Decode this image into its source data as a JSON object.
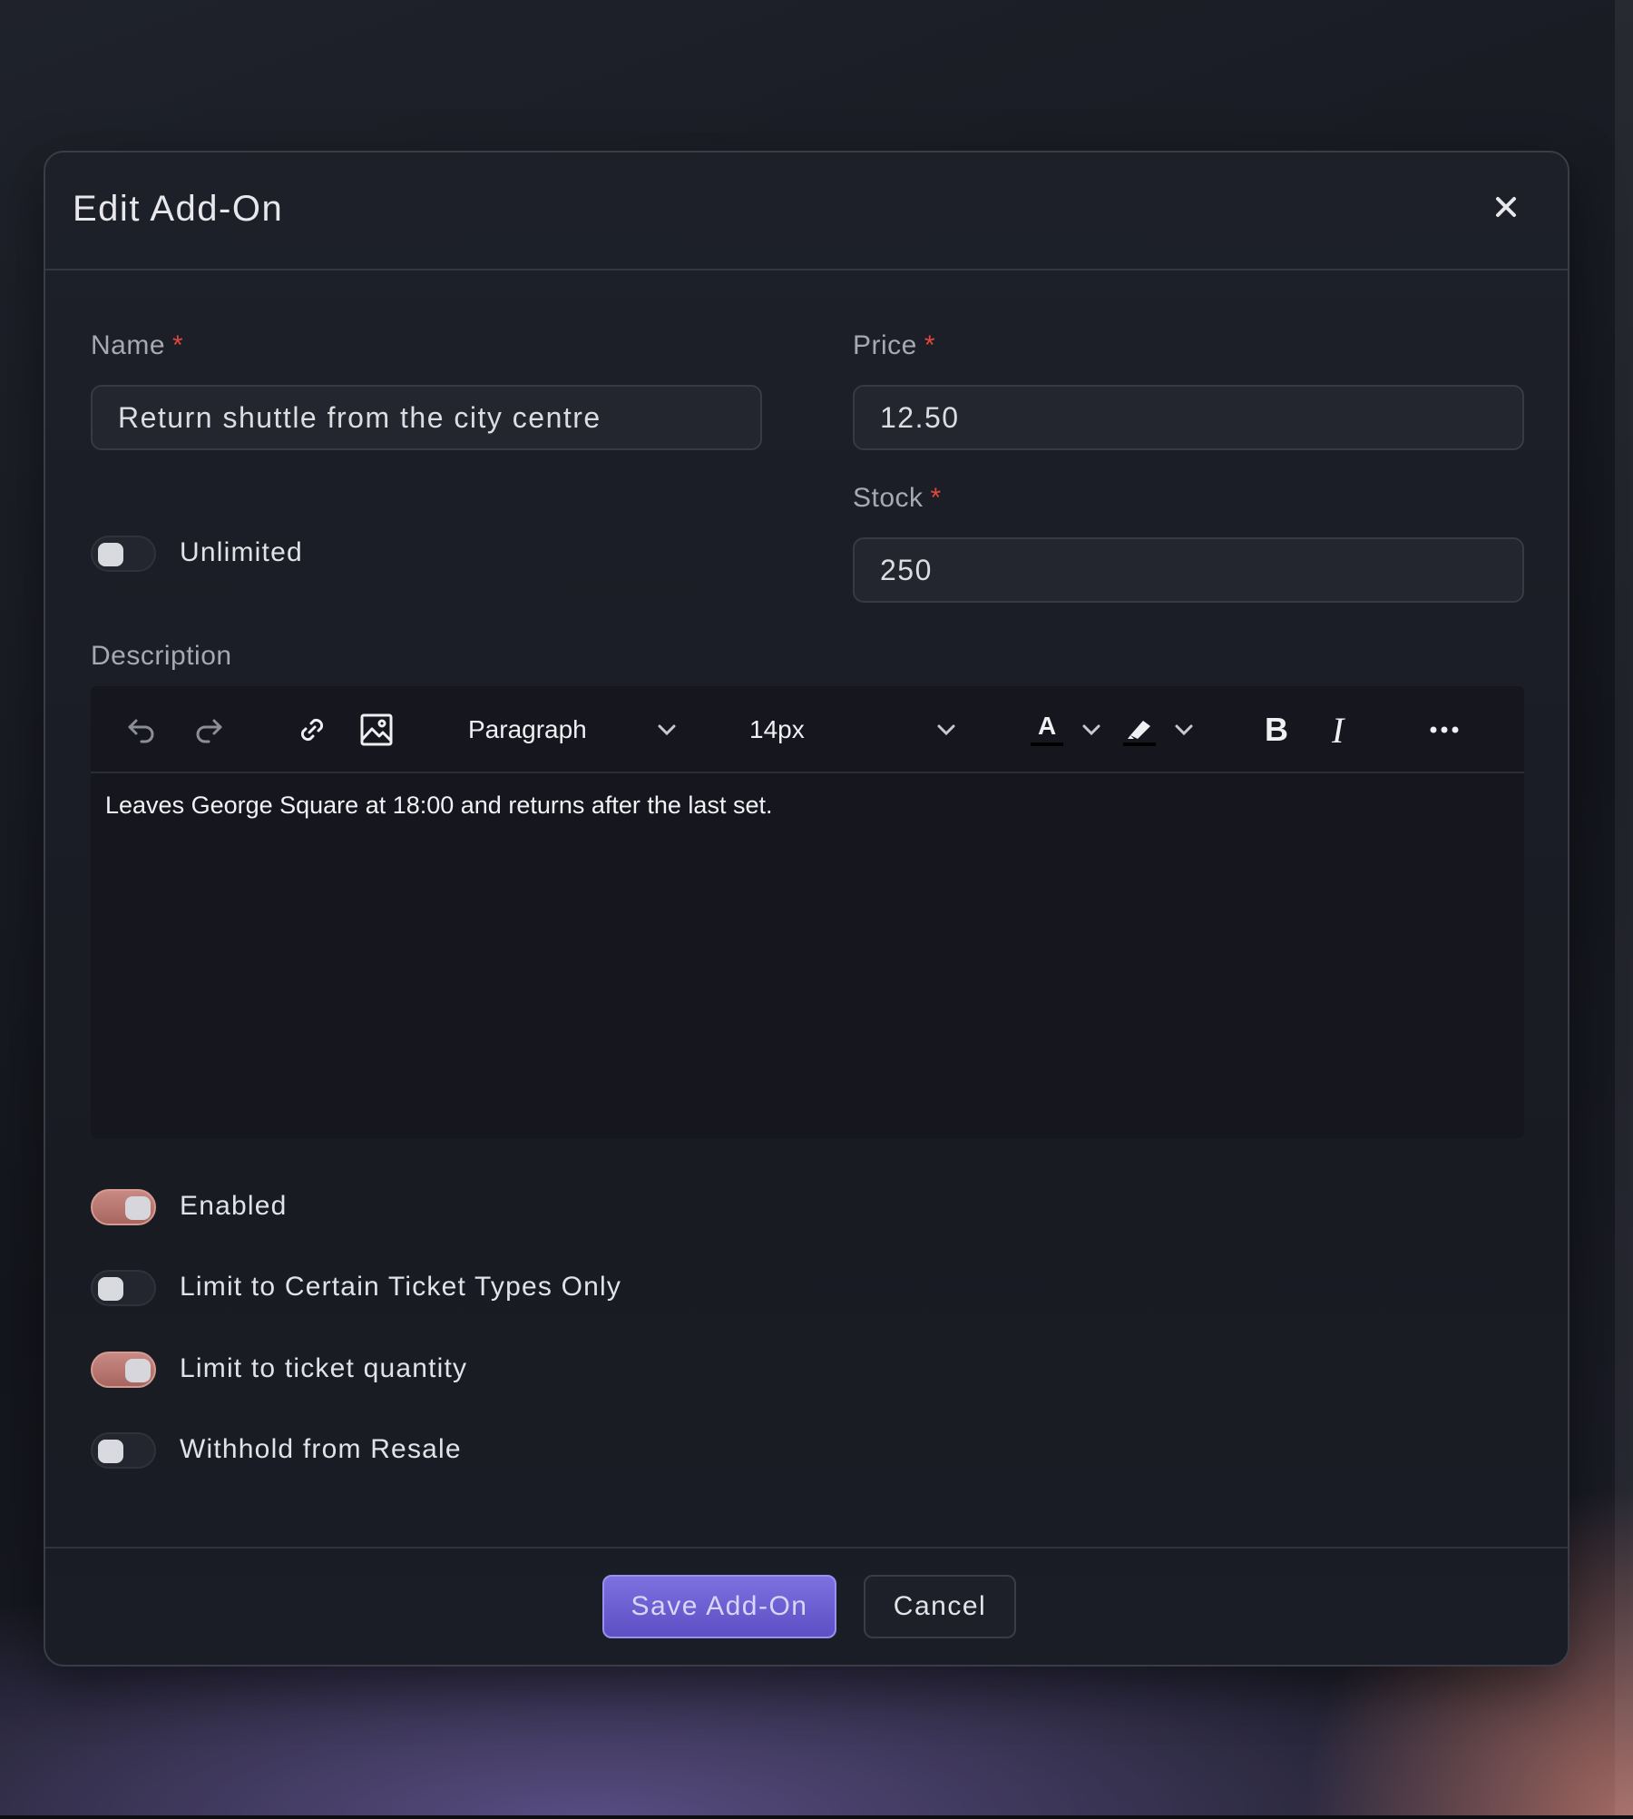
{
  "modal": {
    "title": "Edit Add-On",
    "close_icon": "close-icon"
  },
  "fields": {
    "name": {
      "label": "Name",
      "required_mark": "*",
      "value": "Return shuttle from the city centre"
    },
    "price": {
      "label": "Price",
      "required_mark": "*",
      "value": "12.50"
    },
    "stock": {
      "label": "Stock",
      "required_mark": "*",
      "value": "250"
    },
    "unlimited": {
      "label": "Unlimited",
      "on": false
    }
  },
  "description": {
    "label": "Description",
    "toolbar": {
      "icons": [
        "undo-icon",
        "redo-icon",
        "link-icon",
        "image-icon",
        "chevron-down-icon",
        "text-color-icon",
        "highlight-icon",
        "bold-icon",
        "italic-icon",
        "more-icon"
      ],
      "block_format": "Paragraph",
      "font_size": "14px",
      "bold_label": "B",
      "italic_label": "I",
      "text_color_label": "A"
    },
    "content": "Leaves George Square at 18:00 and returns after the last set."
  },
  "toggles": [
    {
      "label": "Enabled",
      "on": true
    },
    {
      "label": "Limit to Certain Ticket Types Only",
      "on": false
    },
    {
      "label": "Limit to ticket quantity",
      "on": true
    },
    {
      "label": "Withhold from Resale",
      "on": false
    }
  ],
  "actions": {
    "save_label": "Save Add-On",
    "cancel_label": "Cancel"
  },
  "colors": {
    "accent": "#6b5fd6",
    "toggle_on": "#b8746d",
    "required": "#e0463d"
  }
}
